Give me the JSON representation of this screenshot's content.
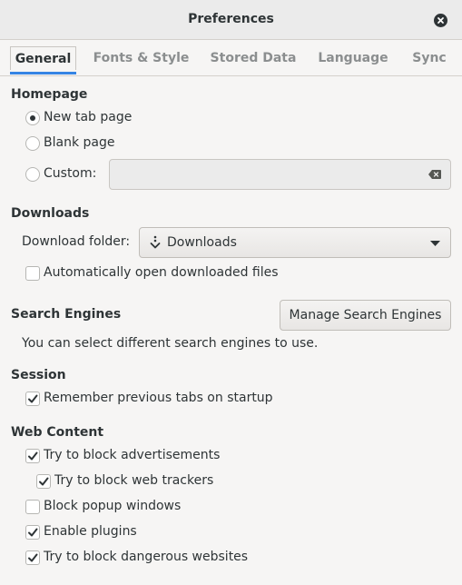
{
  "window": {
    "title": "Preferences"
  },
  "tabs": [
    {
      "label": "General",
      "active": true
    },
    {
      "label": "Fonts & Style",
      "active": false
    },
    {
      "label": "Stored Data",
      "active": false
    },
    {
      "label": "Language",
      "active": false
    },
    {
      "label": "Sync",
      "active": false
    }
  ],
  "homepage": {
    "title": "Homepage",
    "options": [
      {
        "label": "New tab page",
        "selected": true
      },
      {
        "label": "Blank page",
        "selected": false
      },
      {
        "label": "Custom:",
        "selected": false
      }
    ],
    "custom_value": ""
  },
  "downloads": {
    "title": "Downloads",
    "folder_label": "Download folder:",
    "folder_value": "Downloads",
    "auto_open_label": "Automatically open downloaded files",
    "auto_open_checked": false
  },
  "search_engines": {
    "title": "Search Engines",
    "manage_button": "Manage Search Engines",
    "description": "You can select different search engines to use."
  },
  "session": {
    "title": "Session",
    "remember_tabs_label": "Remember previous tabs on startup",
    "remember_tabs_checked": true
  },
  "web_content": {
    "title": "Web Content",
    "block_ads_label": "Try to block advertisements",
    "block_ads_checked": true,
    "block_trackers_label": "Try to block web trackers",
    "block_trackers_checked": true,
    "block_popups_label": "Block popup windows",
    "block_popups_checked": false,
    "enable_plugins_label": "Enable plugins",
    "enable_plugins_checked": true,
    "block_dangerous_label": "Try to block dangerous websites",
    "block_dangerous_checked": true
  },
  "colors": {
    "accent": "#3584e4",
    "text": "#2e3436"
  }
}
